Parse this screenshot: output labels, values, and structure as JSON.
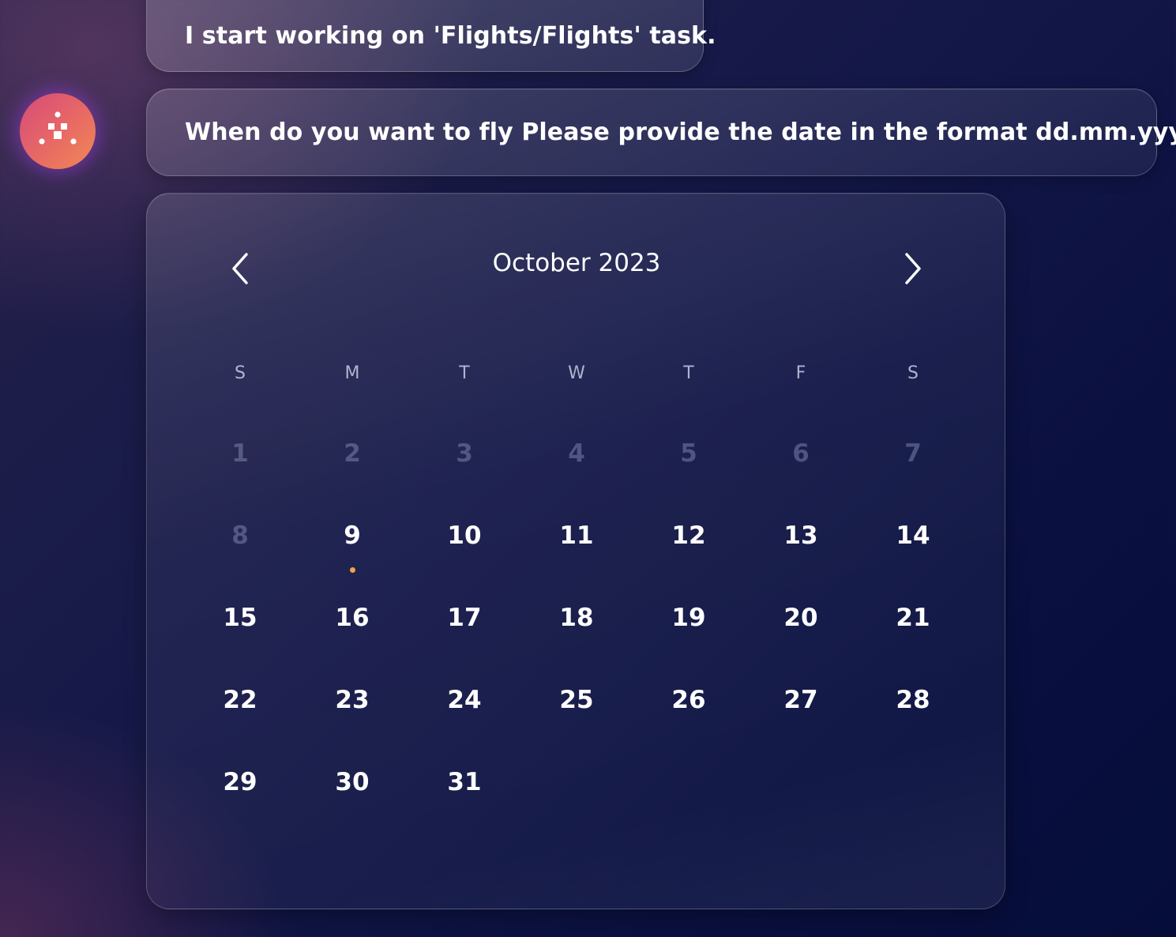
{
  "colors": {
    "accent_dot": "#f2a24a",
    "avatar_gradient_start": "#d64a7a",
    "avatar_gradient_end": "#f08a55",
    "background": "#0d1445"
  },
  "messages": {
    "user": "I start working on 'Flights/Flights' task.",
    "assistant": "When do you want to fly Please provide the date in the format dd.mm.yyyy.?"
  },
  "avatar": {
    "icon": "assistant-logo-icon"
  },
  "calendar": {
    "month_label": "October 2023",
    "prev_icon": "chevron-left-icon",
    "next_icon": "chevron-right-icon",
    "weekdays": [
      "S",
      "M",
      "T",
      "W",
      "T",
      "F",
      "S"
    ],
    "today": "9",
    "weeks": [
      [
        {
          "label": "1",
          "disabled": true
        },
        {
          "label": "2",
          "disabled": true
        },
        {
          "label": "3",
          "disabled": true
        },
        {
          "label": "4",
          "disabled": true
        },
        {
          "label": "5",
          "disabled": true
        },
        {
          "label": "6",
          "disabled": true
        },
        {
          "label": "7",
          "disabled": true
        }
      ],
      [
        {
          "label": "8",
          "disabled": true
        },
        {
          "label": "9",
          "disabled": false
        },
        {
          "label": "10",
          "disabled": false
        },
        {
          "label": "11",
          "disabled": false
        },
        {
          "label": "12",
          "disabled": false
        },
        {
          "label": "13",
          "disabled": false
        },
        {
          "label": "14",
          "disabled": false
        }
      ],
      [
        {
          "label": "15",
          "disabled": false
        },
        {
          "label": "16",
          "disabled": false
        },
        {
          "label": "17",
          "disabled": false
        },
        {
          "label": "18",
          "disabled": false
        },
        {
          "label": "19",
          "disabled": false
        },
        {
          "label": "20",
          "disabled": false
        },
        {
          "label": "21",
          "disabled": false
        }
      ],
      [
        {
          "label": "22",
          "disabled": false
        },
        {
          "label": "23",
          "disabled": false
        },
        {
          "label": "24",
          "disabled": false
        },
        {
          "label": "25",
          "disabled": false
        },
        {
          "label": "26",
          "disabled": false
        },
        {
          "label": "27",
          "disabled": false
        },
        {
          "label": "28",
          "disabled": false
        }
      ],
      [
        {
          "label": "29",
          "disabled": false
        },
        {
          "label": "30",
          "disabled": false
        },
        {
          "label": "31",
          "disabled": false
        }
      ]
    ]
  }
}
